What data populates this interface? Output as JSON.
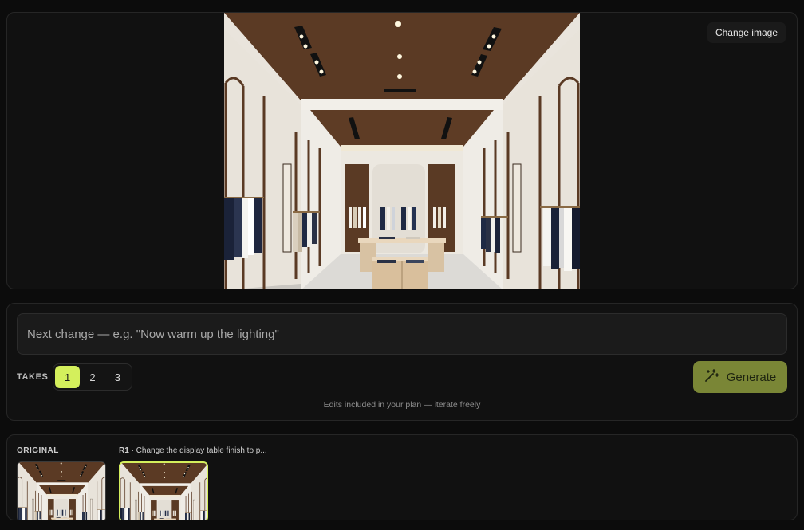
{
  "preview": {
    "change_image_label": "Change image",
    "image_description_name": "boutique-interior"
  },
  "prompt": {
    "placeholder": "Next change — e.g. \"Now warm up the lighting\"",
    "value": ""
  },
  "takes": {
    "label": "TAKES",
    "options": [
      "1",
      "2",
      "3"
    ],
    "selected": "1"
  },
  "generate": {
    "label": "Generate",
    "icon": "magic-wand-icon"
  },
  "plan_note": "Edits included in your plan — iterate freely",
  "history": {
    "original_label": "ORIGINAL",
    "r1_id": "R1",
    "r1_text": " · Change the display table finish to p..."
  },
  "colors": {
    "accent": "#d4ef5c",
    "generate_bg": "#7a8636",
    "panel_bg": "#111111",
    "page_bg": "#0c0c0c"
  }
}
